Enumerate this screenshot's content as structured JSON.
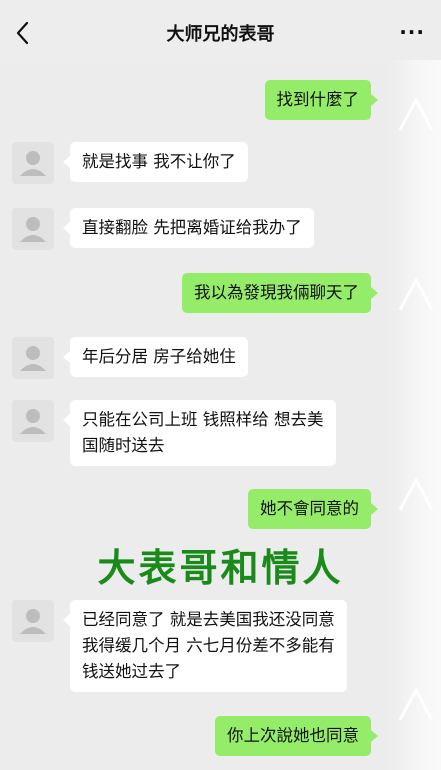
{
  "header": {
    "title": "大师兄的表哥",
    "more": "···"
  },
  "messages": [
    {
      "side": "right",
      "text": "找到什麼了"
    },
    {
      "side": "left",
      "text": "就是找事 我不让你了"
    },
    {
      "side": "left",
      "text": "直接翻脸 先把离婚证给我办了"
    },
    {
      "side": "right",
      "text": "我以為發現我倆聊天了"
    },
    {
      "side": "left",
      "text": "年后分居 房子给她住"
    },
    {
      "side": "left",
      "lines": [
        "只能在公司上班 钱照样给 想去美",
        "国随时送去"
      ]
    },
    {
      "side": "right",
      "text": "她不會同意的"
    },
    {
      "side": "left",
      "lines": [
        "已经同意了 就是去美国我还没同意",
        "我得缓几个月 六七月份差不多能有",
        "钱送她过去了"
      ]
    },
    {
      "side": "right",
      "text": "你上次說她也同意"
    }
  ],
  "overlay_caption": "大表哥和情人",
  "colors": {
    "sent_bubble": "#95ec69",
    "received_bubble": "#ffffff",
    "background": "#ececec",
    "caption": "#1a8b1a"
  },
  "icons": [
    "back-chevron-icon",
    "more-dots-icon",
    "avatar-placeholder-icon"
  ]
}
